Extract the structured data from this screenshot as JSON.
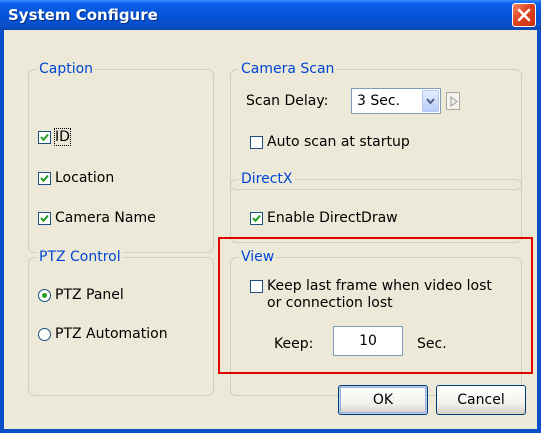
{
  "window": {
    "title": "System Configure"
  },
  "caption": {
    "legend": "Caption",
    "items": [
      {
        "label": "ID",
        "checked": true
      },
      {
        "label": "Location",
        "checked": true
      },
      {
        "label": "Camera Name",
        "checked": true
      }
    ]
  },
  "camera_scan": {
    "legend": "Camera Scan",
    "scan_delay_label": "Scan Delay:",
    "scan_delay_value": "3 Sec.",
    "auto_scan_label": "Auto scan at startup",
    "auto_scan_checked": false
  },
  "directx": {
    "legend": "DirectX",
    "enable_label": "Enable DirectDraw",
    "enable_checked": true
  },
  "ptz": {
    "legend": "PTZ Control",
    "options": [
      {
        "label": "PTZ Panel",
        "selected": true
      },
      {
        "label": "PTZ Automation",
        "selected": false
      }
    ]
  },
  "view": {
    "legend": "View",
    "keep_frame_line1": "Keep last frame when video lost",
    "keep_frame_line2": "or connection lost",
    "keep_frame_checked": false,
    "keep_label": "Keep:",
    "keep_value": "10",
    "keep_unit": "Sec."
  },
  "buttons": {
    "ok": "OK",
    "cancel": "Cancel"
  },
  "colors": {
    "title_bar": "#0553d9",
    "legend_text": "#0046d5",
    "dialog_bg": "#ece9d8",
    "highlight": "#e00000",
    "check_mark": "#21a121"
  },
  "icons": {
    "close": "close-icon",
    "dropdown": "chevron-down-icon",
    "scan_next": "play-right-icon",
    "check": "checkmark-icon"
  }
}
